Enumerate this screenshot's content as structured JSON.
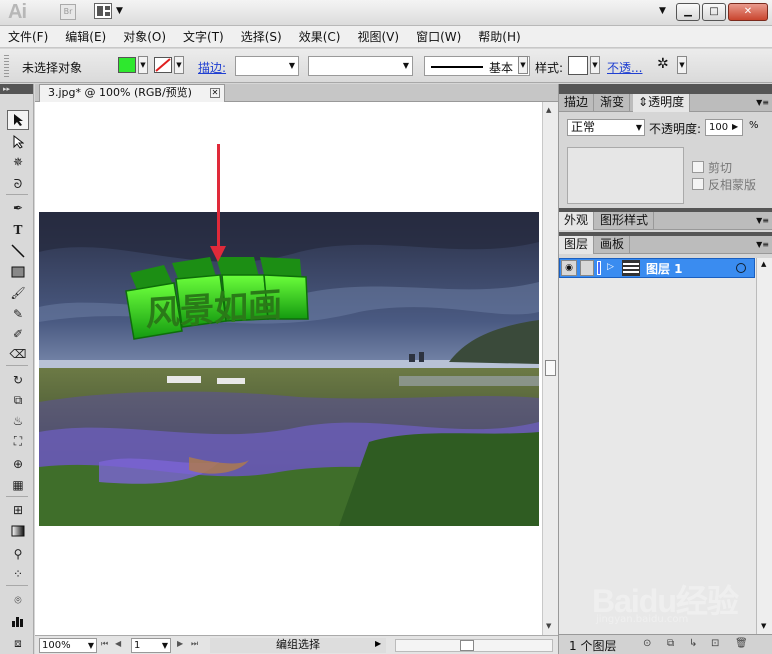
{
  "app": {
    "logo": "Ai",
    "bridge_label": "Br",
    "win_min": "▁",
    "win_max": "□",
    "win_close": "✕"
  },
  "menu": [
    "文件(F)",
    "编辑(E)",
    "对象(O)",
    "文字(T)",
    "选择(S)",
    "效果(C)",
    "视图(V)",
    "窗口(W)",
    "帮助(H)"
  ],
  "control": {
    "selection_status": "未选择对象",
    "fill_color": "#2ee82e",
    "stroke_label": "描边:",
    "stroke_style": "基本",
    "style_label": "样式:",
    "opacity_link": "不透..."
  },
  "document": {
    "tab_title": "3.jpg* @ 100% (RGB/预览)",
    "arrow_color": "#e02a3a",
    "photo_text": "风景如画"
  },
  "status": {
    "zoom": "100%",
    "page": "1",
    "mode": "编组选择"
  },
  "panels": {
    "top_tabs": [
      "描边",
      "渐变",
      "透明度"
    ],
    "blend_mode": "正常",
    "opacity_label": "不透明度:",
    "opacity_value": "100",
    "opacity_unit": "%",
    "clip_label": "剪切",
    "invert_mask_label": "反相蒙版",
    "mid_tabs": [
      "外观",
      "图形样式"
    ],
    "layer_tabs": [
      "图层",
      "画板"
    ],
    "layer_name": "图层 1",
    "layer_count": "1 个图层"
  },
  "watermark": {
    "brand": "Baidu经验",
    "url": "jingyan.baidu.com"
  }
}
